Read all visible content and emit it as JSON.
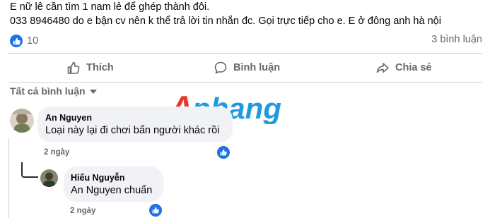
{
  "post": {
    "lines": [
      "E nữ lê cần tìm 1 nam lẻ để ghép thành đôi.",
      "033 8946480 do e bận cv nên k thể trả lời tin nhắn đc. Gọi trực tiếp cho e. E ở đông anh hà nội"
    ]
  },
  "stats": {
    "likes": "10",
    "comments": "3 bình luận"
  },
  "actions": {
    "like": "Thích",
    "comment": "Bình luận",
    "share": "Chia sẻ"
  },
  "filter": {
    "label": "Tất cả bình luận"
  },
  "watermark": {
    "text": "Aphang"
  },
  "comments": [
    {
      "name": "An Nguyen",
      "text": "Loại này lại đi chơi bẩn người khác rồi",
      "time": "2 ngày"
    },
    {
      "name": "Hiếu Nguyễn",
      "text": "An Nguyen chuẩn",
      "time": "2 ngày"
    }
  ],
  "colors": {
    "accent": "#1b74e4",
    "secondary_text": "#65676b",
    "bubble": "#f0f2f5",
    "watermark_red": "#e8382e",
    "watermark_blue": "#1e9be0"
  }
}
